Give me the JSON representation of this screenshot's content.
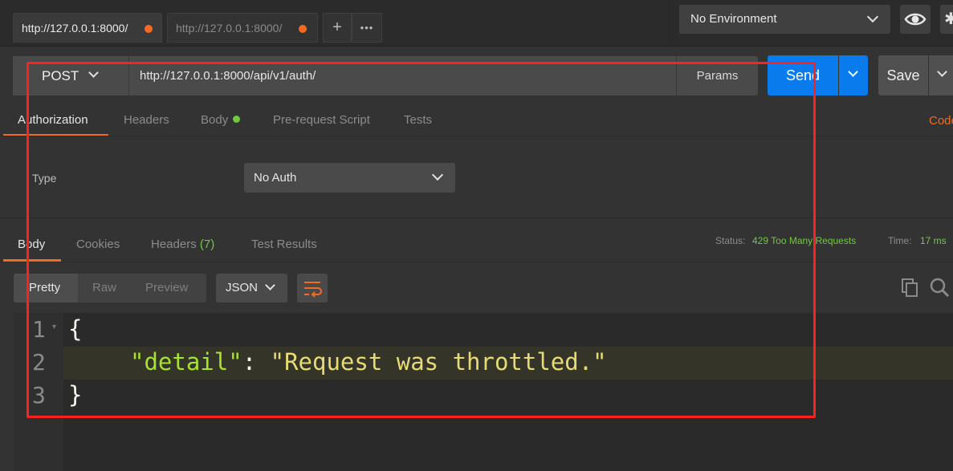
{
  "tabs": [
    {
      "title": "http://127.0.0.1:8000/"
    },
    {
      "title": "http://127.0.0.1:8000/"
    }
  ],
  "tab_actions": {
    "add": "+",
    "more": "•••"
  },
  "environment": {
    "selected": "No Environment"
  },
  "request": {
    "method": "POST",
    "url": "http://127.0.0.1:8000/api/v1/auth/",
    "params_label": "Params",
    "send_label": "Send",
    "save_label": "Save"
  },
  "request_tabs": {
    "authorization": "Authorization",
    "headers": "Headers",
    "body": "Body",
    "prerequest": "Pre-request Script",
    "tests": "Tests",
    "code": "Code"
  },
  "auth": {
    "type_label": "Type",
    "type_value": "No Auth"
  },
  "response_tabs": {
    "body": "Body",
    "cookies": "Cookies",
    "headers": "Headers",
    "headers_count": "(7)",
    "test_results": "Test Results"
  },
  "response_status": {
    "status_label": "Status:",
    "status_value": "429 Too Many Requests",
    "time_label": "Time:",
    "time_value": "17 ms"
  },
  "view_modes": {
    "pretty": "Pretty",
    "raw": "Raw",
    "preview": "Preview",
    "format": "JSON"
  },
  "response_body": {
    "line_numbers": [
      "1",
      "2",
      "3"
    ],
    "open_brace": "{",
    "key": "\"detail\"",
    "colon": ": ",
    "value": "\"Request was throttled.\"",
    "close_brace": "}"
  },
  "colors": {
    "accent": "#f26b21",
    "send": "#097bed",
    "success": "#71c940",
    "annotation": "#ff2020"
  }
}
